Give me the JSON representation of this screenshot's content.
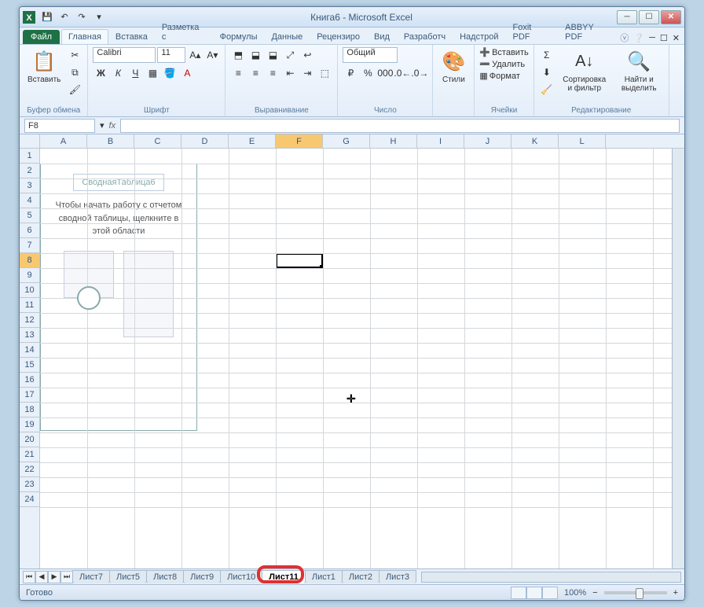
{
  "title": "Книга6 - Microsoft Excel",
  "qat": [
    "save",
    "undo",
    "redo",
    "print",
    "new"
  ],
  "tabs": {
    "file": "Файл",
    "items": [
      "Главная",
      "Вставка",
      "Разметка с",
      "Формулы",
      "Данные",
      "Рецензиро",
      "Вид",
      "Разработч",
      "Надстрой",
      "Foxit PDF",
      "ABBYY PDF"
    ],
    "active": 0
  },
  "ribbon": {
    "clipboard": {
      "paste": "Вставить",
      "label": "Буфер обмена"
    },
    "font": {
      "name": "Calibri",
      "size": "11",
      "label": "Шрифт",
      "bold": "Ж",
      "italic": "К",
      "underline": "Ч"
    },
    "alignment": {
      "label": "Выравнивание"
    },
    "number": {
      "format": "Общий",
      "label": "Число"
    },
    "styles": {
      "btn": "Стили"
    },
    "cells": {
      "insert": "Вставить",
      "delete": "Удалить",
      "format": "Формат",
      "label": "Ячейки"
    },
    "editing": {
      "sort": "Сортировка и фильтр",
      "find": "Найти и выделить",
      "label": "Редактирование"
    }
  },
  "namebox": "F8",
  "columns": [
    "A",
    "B",
    "C",
    "D",
    "E",
    "F",
    "G",
    "H",
    "I",
    "J",
    "K",
    "L"
  ],
  "active_col_index": 5,
  "rows": [
    1,
    2,
    3,
    4,
    5,
    6,
    7,
    8,
    9,
    10,
    11,
    12,
    13,
    14,
    15,
    16,
    17,
    18,
    19,
    20,
    21,
    22,
    23,
    24
  ],
  "active_row": 8,
  "pivot": {
    "title": "СводнаяТаблица6",
    "text": "Чтобы начать работу с отчетом сводной таблицы, щелкните в этой области"
  },
  "sheet_tabs": [
    "Лист7",
    "Лист5",
    "Лист8",
    "Лист9",
    "Лист10",
    "Лист11",
    "Лист1",
    "Лист2",
    "Лист3"
  ],
  "active_sheet": 5,
  "status": "Готово",
  "zoom": "100%"
}
